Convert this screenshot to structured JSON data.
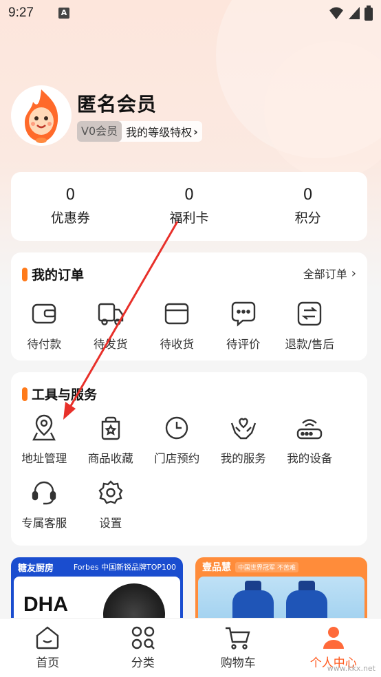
{
  "status": {
    "time": "9:27"
  },
  "profile": {
    "username": "匿名会员",
    "level_badge": "V0会员",
    "level_link": "我的等级特权"
  },
  "stats": [
    {
      "value": "0",
      "label": "优惠券"
    },
    {
      "value": "0",
      "label": "福利卡"
    },
    {
      "value": "0",
      "label": "积分"
    }
  ],
  "orders": {
    "title": "我的订单",
    "all_label": "全部订单",
    "items": [
      {
        "label": "待付款",
        "icon": "wallet-icon"
      },
      {
        "label": "待发货",
        "icon": "truck-icon"
      },
      {
        "label": "待收货",
        "icon": "box-icon"
      },
      {
        "label": "待评价",
        "icon": "chat-icon"
      },
      {
        "label": "退款/售后",
        "icon": "refund-icon"
      }
    ]
  },
  "tools": {
    "title": "工具与服务",
    "items": [
      {
        "label": "地址管理",
        "icon": "location-icon"
      },
      {
        "label": "商品收藏",
        "icon": "favorite-bag-icon"
      },
      {
        "label": "门店预约",
        "icon": "clock-icon"
      },
      {
        "label": "我的服务",
        "icon": "heart-hands-icon"
      },
      {
        "label": "我的设备",
        "icon": "router-icon"
      },
      {
        "label": "专属客服",
        "icon": "headset-icon"
      },
      {
        "label": "设置",
        "icon": "settings-icon"
      }
    ]
  },
  "banners": {
    "left": {
      "brand": "糖友厨房",
      "tag": "Forbes 中国新锐品牌TOP100",
      "product": "DHA"
    },
    "right": {
      "brand": "壹品慧",
      "tag": "中国世界冠军 不苦难"
    }
  },
  "tabbar": [
    {
      "label": "首页",
      "icon": "home-icon"
    },
    {
      "label": "分类",
      "icon": "category-icon"
    },
    {
      "label": "购物车",
      "icon": "cart-icon"
    },
    {
      "label": "个人中心",
      "icon": "user-icon",
      "active": true
    }
  ],
  "colors": {
    "accent": "#ff7a1a",
    "active_tab": "#ff5a1f",
    "annotation_arrow": "#e8302a"
  },
  "watermark": "www.kkx.net"
}
